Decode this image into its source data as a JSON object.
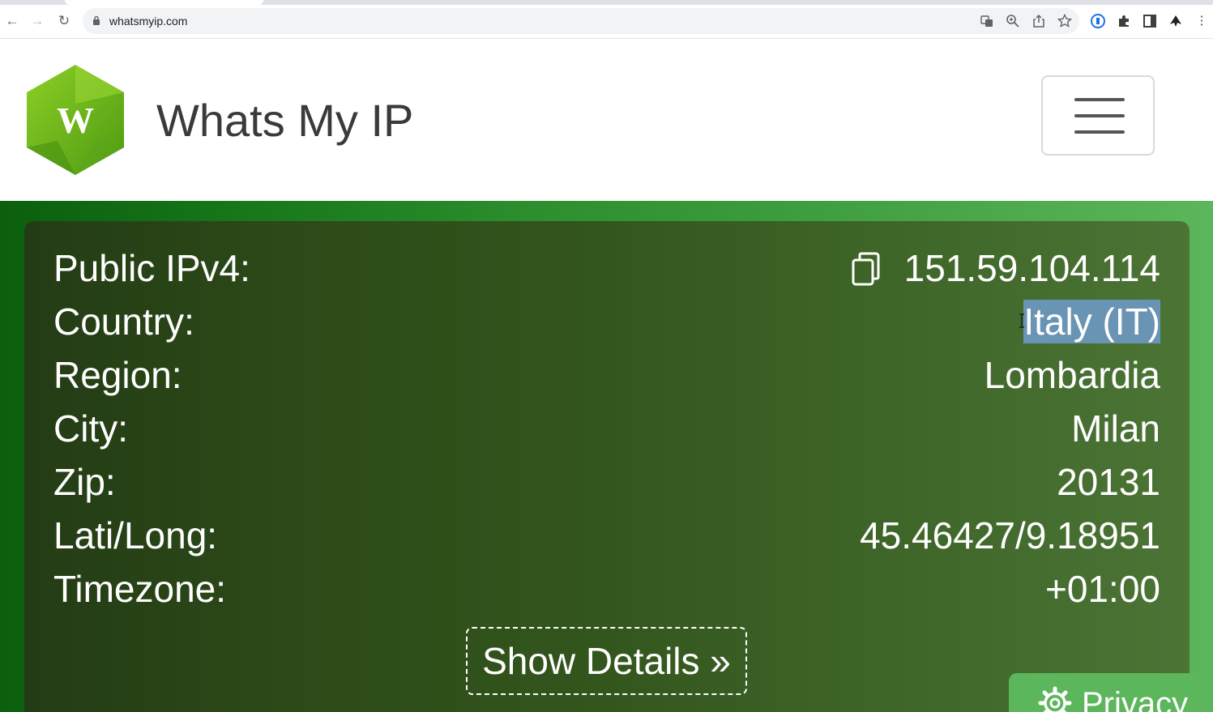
{
  "browser": {
    "url": "whatsmyip.com",
    "back_glyph": "←",
    "forward_glyph": "→",
    "reload_glyph": "↻",
    "more_glyph": "⋮",
    "icons": [
      "translate-icon",
      "zoom-icon",
      "share-icon",
      "bookmark-star-icon",
      "extension-icon",
      "puzzle-icon",
      "sidepanel-icon",
      "profile-icon",
      "more-icon"
    ]
  },
  "site": {
    "logo_letter": "W",
    "title": "Whats My IP",
    "brand_green": "#6cb31c"
  },
  "info": {
    "rows": [
      {
        "label": "Public IPv4:",
        "value": "151.59.104.114"
      },
      {
        "label": "Country:",
        "value": "Italy (IT)"
      },
      {
        "label": "Region:",
        "value": "Lombardia"
      },
      {
        "label": "City:",
        "value": "Milan"
      },
      {
        "label": "Zip:",
        "value": "20131"
      },
      {
        "label": "Lati/Long:",
        "value": "45.46427/9.18951"
      },
      {
        "label": "Timezone:",
        "value": "+01:00"
      }
    ],
    "show_details": "Show Details »"
  },
  "privacy": {
    "label": "Privacy"
  },
  "colors": {
    "selection": "#6a94b4",
    "panel_dark": "#243c15",
    "hero_light": "#5cb65b"
  }
}
